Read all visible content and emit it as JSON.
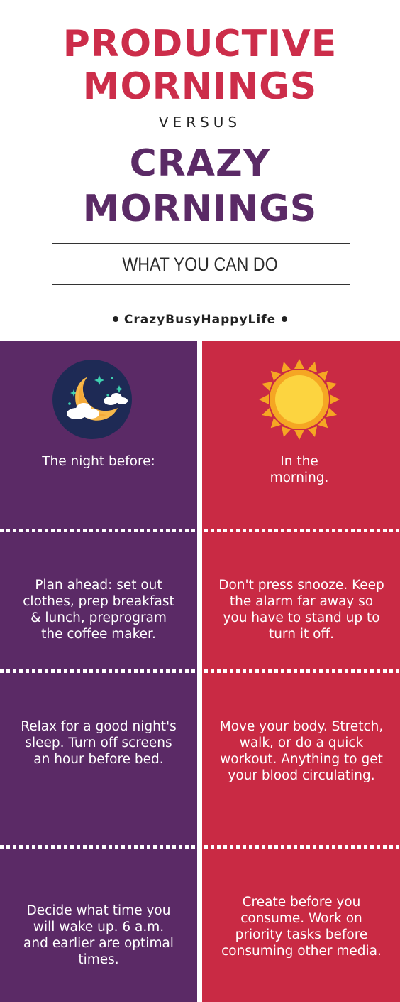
{
  "header": {
    "title_line1": "PRODUCTIVE",
    "title_line2": "MORNINGS",
    "versus": "VERSUS",
    "title2_line1": "CRAZY",
    "title2_line2": "MORNINGS",
    "subtitle": "WHAT YOU CAN DO",
    "brand": "CrazyBusyHappyLife"
  },
  "icons": {
    "left": "moon-night-icon",
    "right": "sun-icon"
  },
  "colors": {
    "accent_red": "#cc2d4a",
    "accent_purple": "#5b2a66",
    "left_column": "#5b2a66",
    "right_column": "#c92a44",
    "sun": "#f5a623",
    "moon": "#f7b84a"
  },
  "rows": [
    {
      "left": "The night before:",
      "right": "In the morning."
    },
    {
      "left": "Plan ahead: set out clothes, prep breakfast & lunch, preprogram the coffee maker.",
      "right": "Don't press snooze. Keep the alarm far away so you have to stand up to turn it off."
    },
    {
      "left": "Relax for a good night's sleep. Turn off screens an hour before bed.",
      "right": "Move your body. Stretch, walk, or do a quick workout. Anything to get your blood circulating."
    },
    {
      "left": "Decide what time you will wake up. 6 a.m. and earlier are optimal times.",
      "right": "Create before you consume. Work on priority tasks before consuming other media."
    }
  ]
}
